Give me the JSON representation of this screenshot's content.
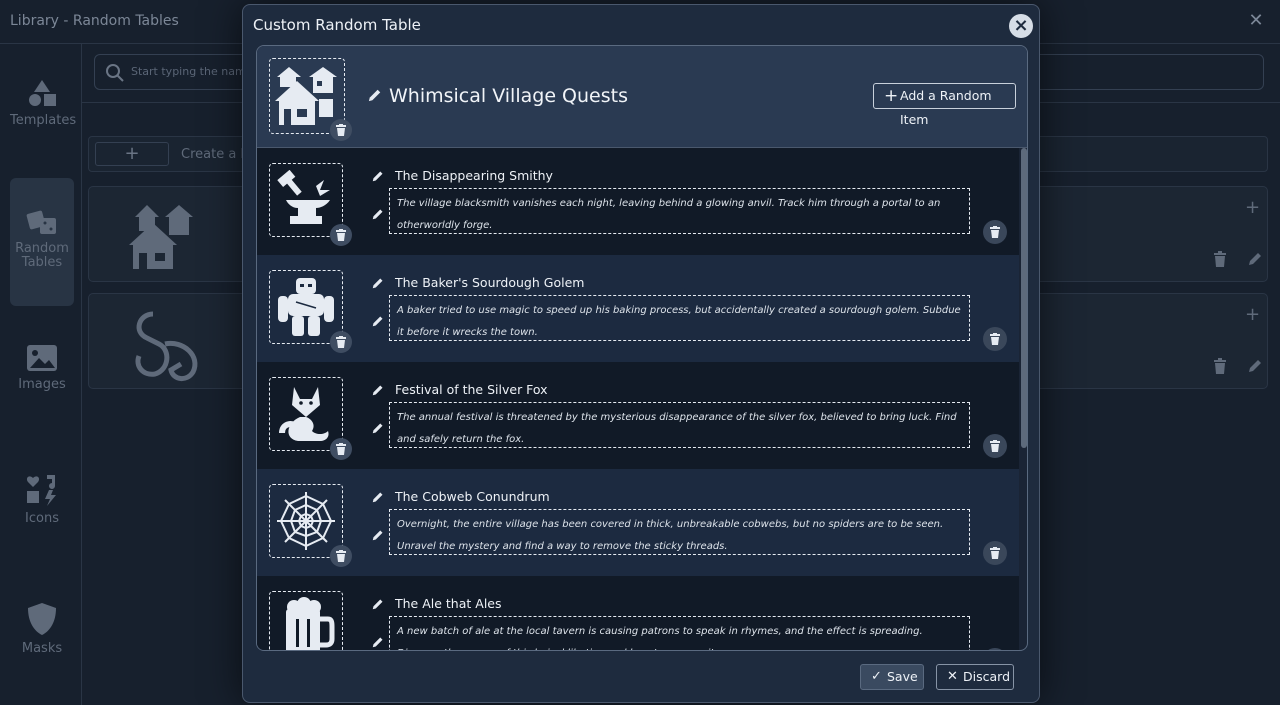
{
  "library": {
    "title": "Library - Random Tables",
    "search_placeholder": "Start typing the name",
    "create_label": "Create a R",
    "nav": [
      {
        "label": "Templates",
        "icon": "shapes-icon"
      },
      {
        "label": "Random Tables",
        "icon": "dice-icon"
      },
      {
        "label": "Images",
        "icon": "image-icon"
      },
      {
        "label": "Icons",
        "icon": "icons-icon"
      },
      {
        "label": "Masks",
        "icon": "shield-icon"
      }
    ]
  },
  "modal": {
    "title": "Custom Random Table",
    "table_name": "Whimsical Village Quests",
    "add_item_label": "Add a Random Item",
    "save_label": "Save",
    "discard_label": "Discard",
    "items": [
      {
        "title": "The Disappearing Smithy",
        "description": "The village blacksmith vanishes each night, leaving behind a glowing anvil. Track him through a portal to an otherworldly forge.",
        "icon": "anvil-icon"
      },
      {
        "title": "The Baker's Sourdough Golem",
        "description": "A baker tried to use magic to speed up his baking process, but accidentally created a sourdough golem. Subdue it before it wrecks the town.",
        "icon": "golem-icon"
      },
      {
        "title": "Festival of the Silver Fox",
        "description": "The annual festival is threatened by the mysterious disappearance of the silver fox, believed to bring luck. Find and safely return the fox.",
        "icon": "fox-icon"
      },
      {
        "title": "The Cobweb Conundrum",
        "description": "Overnight, the entire village has been covered in thick, unbreakable cobwebs, but no spiders are to be seen. Unravel the mystery and find a way to remove the sticky threads.",
        "icon": "spiderweb-icon"
      },
      {
        "title": "The Ale that Ales",
        "description": "A new batch of ale at the local tavern is causing patrons to speak in rhymes, and the effect is spreading. Discover the source of this lyrical libation and how to reverse it.",
        "icon": "beer-mug-icon"
      }
    ]
  }
}
